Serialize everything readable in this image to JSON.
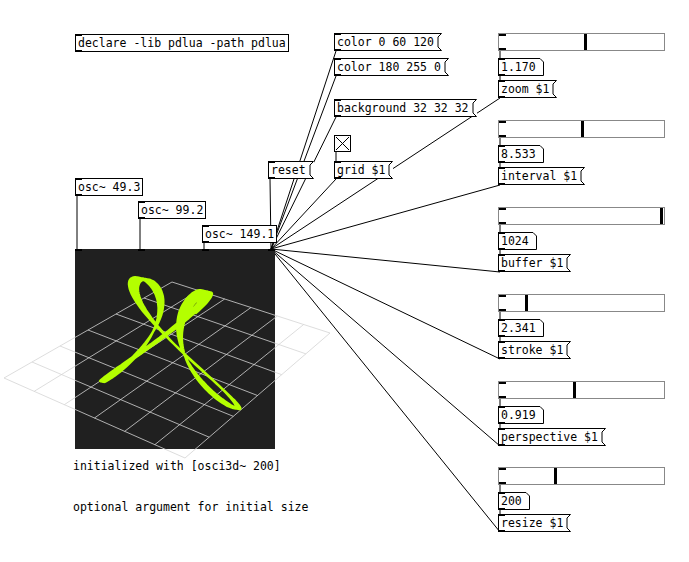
{
  "declare": "declare -lib pdlua -path pdlua",
  "oscillators": [
    "osc~ 49.3",
    "osc~ 99.2",
    "osc~ 149.1"
  ],
  "messages": [
    "color 0 60 120",
    "color 180 255 0",
    "background 32 32 32",
    "reset"
  ],
  "toggle": {
    "label": "grid $1",
    "checked": true
  },
  "controls": [
    {
      "level": 0.53,
      "value": "1.170",
      "message": "zoom $1"
    },
    {
      "level": 0.51,
      "value": "8.533",
      "message": "interval $1"
    },
    {
      "level": 1.0,
      "value": "1024",
      "message": "buffer $1"
    },
    {
      "level": 0.16,
      "value": "2.341",
      "message": "stroke $1"
    },
    {
      "level": 0.46,
      "value": "0.919",
      "message": "perspective $1"
    },
    {
      "level": 0.34,
      "value": "200",
      "message": "resize $1"
    }
  ],
  "comments": [
    "initialized with [osci3d~ 200]",
    "optional argument for initial size"
  ]
}
